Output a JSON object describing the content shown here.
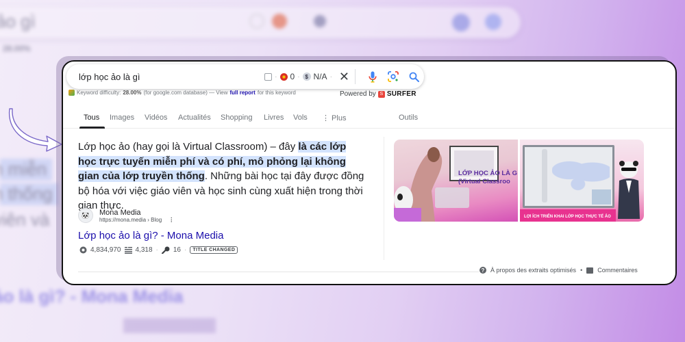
{
  "search": {
    "query": "lớp học ảo là gì",
    "ext_count": "0",
    "ext_cpc": "N/A",
    "ext_dollar": "$"
  },
  "keyword_bar": {
    "label": "Keyword difficulty:",
    "value": "28.00%",
    "db_note": "(for google.com database) — View",
    "link": "full report",
    "suffix": "for this keyword"
  },
  "powered": {
    "prefix": "Powered by",
    "brand": "SURFER",
    "logo_glyph": "S"
  },
  "tabs": [
    {
      "label": "Tous",
      "active": true
    },
    {
      "label": "Images"
    },
    {
      "label": "Vidéos"
    },
    {
      "label": "Actualités"
    },
    {
      "label": "Shopping"
    },
    {
      "label": "Livres"
    },
    {
      "label": "Vols"
    },
    {
      "label": "⋮ Plus"
    },
    {
      "label": "Outils"
    }
  ],
  "snippet": {
    "intro": "Lớp học ảo (hay gọi là Virtual Classroom) – đây ",
    "highlight": "là các lớp học trực tuyến miễn phí và có phí, mô phỏng lại không gian của lớp truyền thống",
    "rest": ". Những bài học tại đây được đồng bộ hóa với việc giáo viên và học sinh cùng xuất hiện trong thời gian thực."
  },
  "source": {
    "name": "Mona Media",
    "url": "https://mona.media",
    "breadcrumb": "› Blog",
    "favicon_glyph": "🐼",
    "kebab": "⋮"
  },
  "result": {
    "title": "Lớp học ảo là gì? - Mona Media"
  },
  "metrics": {
    "traffic": "4,834,970",
    "words": "4,318",
    "keywords": "16",
    "badge": "TITLE CHANGED"
  },
  "images": {
    "thumb1_title_line1": "LỚP HỌC ẢO LÀ G",
    "thumb1_title_line2": "(Virtual Classroo",
    "thumb2_caption": "LỢI ÍCH TRIỂN KHAI LỚP HỌC THỰC TẾ ẢO"
  },
  "footer": {
    "about": "À propos des extraits optimisés",
    "separator": "•",
    "feedback": "Commentaires"
  },
  "background": {
    "query_fragment": "ảo gì",
    "line1": "n miễn",
    "line2": "n thống",
    "line3": "viên và",
    "title_fragment": "ảo là gì? - Mona Media",
    "pct": "28.00%"
  },
  "colors": {
    "link": "#1a0dab",
    "highlight": "#d3e3fd",
    "accent_purple": "#c38ce6"
  }
}
